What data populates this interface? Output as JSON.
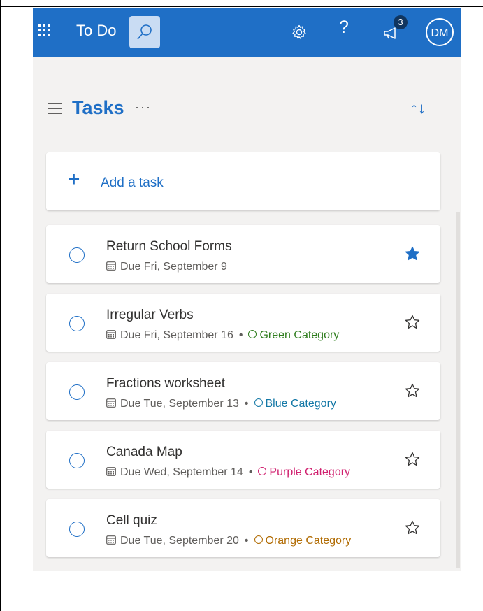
{
  "header": {
    "app_title": "To Do",
    "notification_count": "3",
    "avatar_initials": "DM",
    "help_label": "?"
  },
  "list": {
    "title": "Tasks",
    "more_label": "···",
    "sort_label": "↑↓"
  },
  "add_task": {
    "label": "Add a task"
  },
  "tasks": [
    {
      "title": "Return School Forms",
      "due": "Due Fri, September 9",
      "category": "",
      "category_color": "",
      "important": true
    },
    {
      "title": "Irregular Verbs",
      "due": "Due Fri, September 16",
      "category": "Green Category",
      "category_color": "#2f7d1e",
      "important": false
    },
    {
      "title": "Fractions worksheet",
      "due": "Due Tue, September 13",
      "category": "Blue Category",
      "category_color": "#1478a6",
      "important": false
    },
    {
      "title": "Canada Map",
      "due": "Due Wed, September 14",
      "category": "Purple Category",
      "category_color": "#d0206f",
      "important": false
    },
    {
      "title": "Cell quiz",
      "due": "Due Tue, September 20",
      "category": "Orange Category",
      "category_color": "#b06a00",
      "important": false
    }
  ],
  "colors": {
    "accent": "#1f6fc6",
    "page_bg": "#f3f2f1",
    "search_active_bg": "#c9dcf3"
  },
  "icons": [
    "app-launcher-icon",
    "search-icon",
    "gear-icon",
    "help-icon",
    "megaphone-icon",
    "hamburger-icon",
    "sort-icon",
    "plus-icon",
    "calendar-icon",
    "star-icon"
  ]
}
